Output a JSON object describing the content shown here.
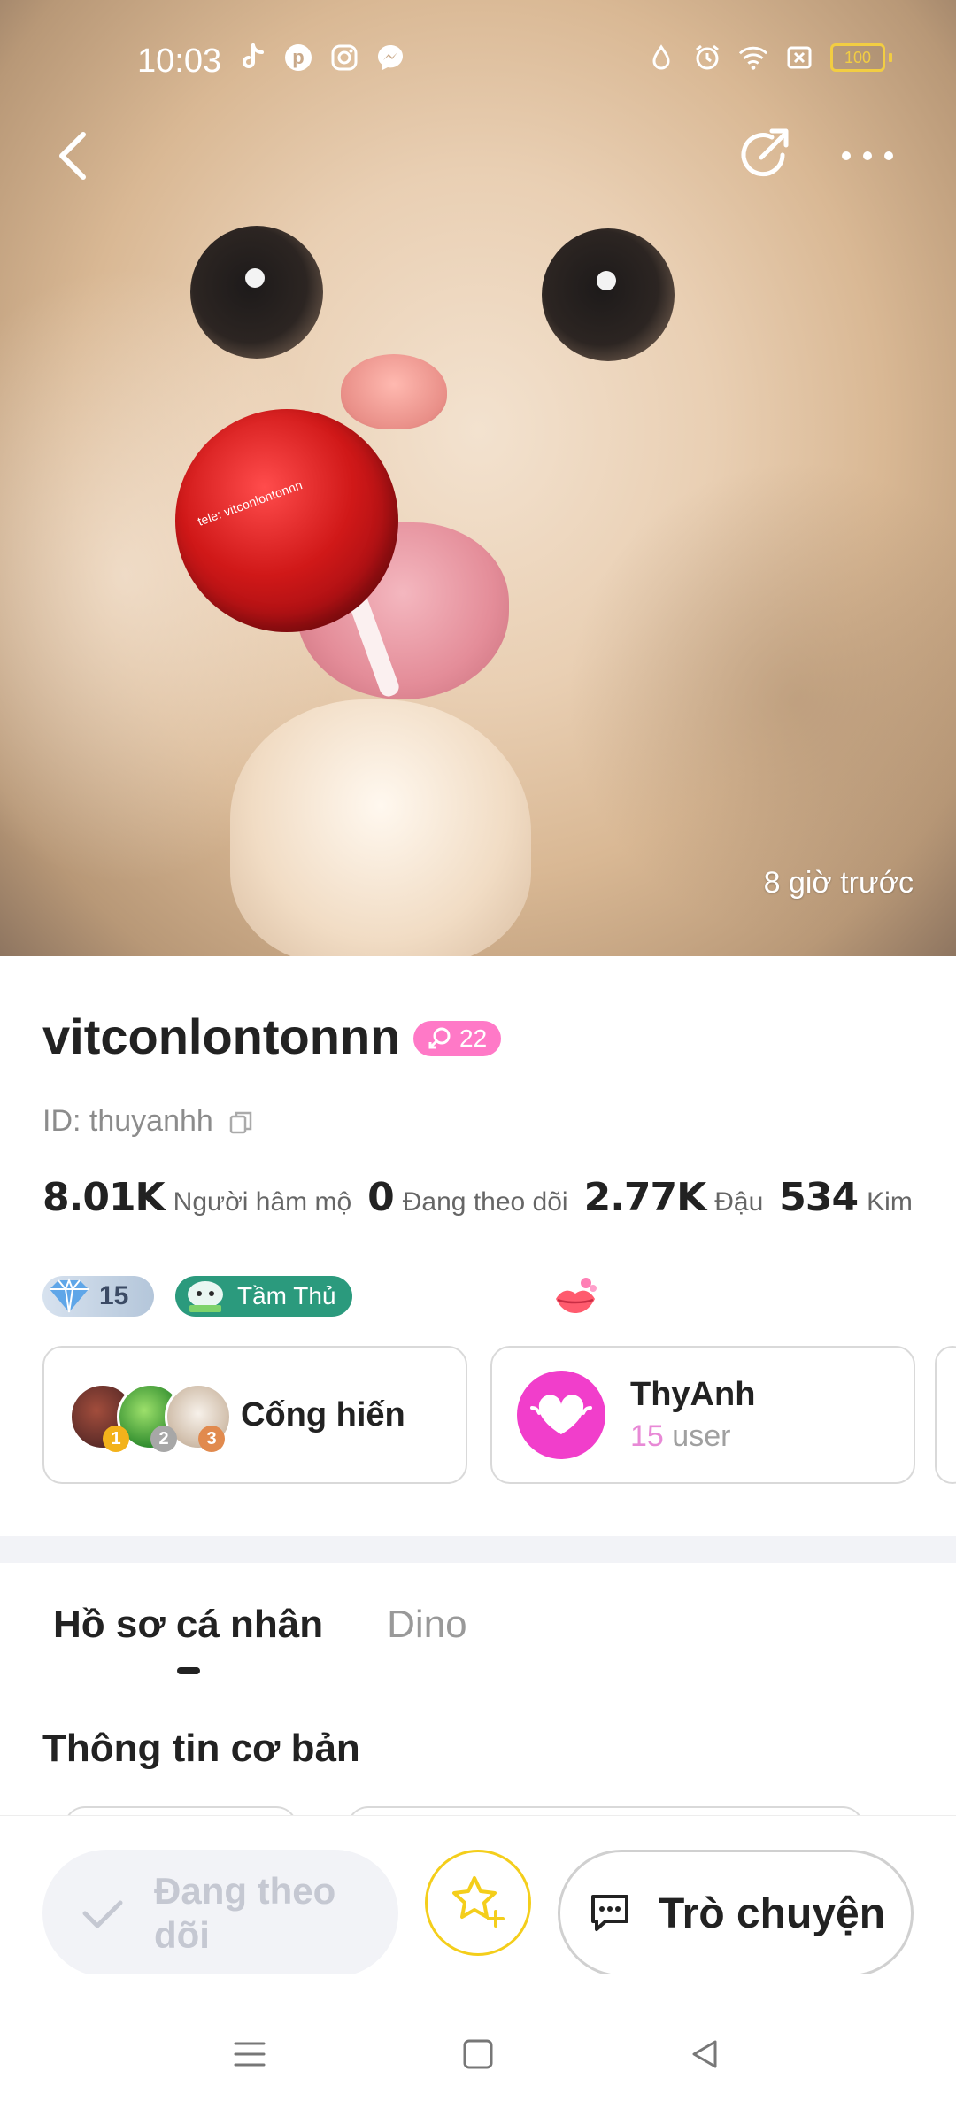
{
  "status_bar": {
    "time": "10:03",
    "app_icons": [
      "tiktok-icon",
      "pinterest-icon",
      "instagram-icon",
      "messenger-icon"
    ],
    "system_icons": [
      "water-drop-icon",
      "alarm-icon",
      "wifi-icon",
      "sim-x-icon"
    ],
    "battery": "100"
  },
  "header": {
    "back_icon": "chevron-left-icon",
    "share_icon": "share-icon",
    "more_icon": "more-dots-icon"
  },
  "photo": {
    "lollipop_text": "tele: vitconlontonnn",
    "timestamp": "8 giờ trước"
  },
  "profile": {
    "username": "vitconlontonnn",
    "level": "22",
    "id_label": "ID: thuyanhh",
    "stats": [
      {
        "value": "8.01K",
        "label": "Người hâm mộ"
      },
      {
        "value": "0",
        "label": "Đang theo dõi"
      },
      {
        "value": "2.77K",
        "label": "Đậu"
      },
      {
        "value": "534",
        "label": "Kim"
      }
    ],
    "diamond_count": "15",
    "rank_badge": "Tầm Thủ"
  },
  "cards": {
    "contribution": {
      "label": "Cống hiến",
      "ranks": [
        "1",
        "2",
        "3"
      ]
    },
    "fan_club": {
      "name": "ThyAnh",
      "count": "15",
      "unit": "user"
    }
  },
  "tabs": [
    {
      "label": "Hồ sơ cá nhân",
      "active": true
    },
    {
      "label": "Dino",
      "active": false
    }
  ],
  "section": {
    "title": "Thông tin cơ bản"
  },
  "actions": {
    "follow_line1": "Đang theo",
    "follow_line2": "dõi",
    "chat_label": "Trò chuyện"
  },
  "colors": {
    "level_pink": "#ff79c7",
    "rank_green": "#2b9a7d",
    "fan_magenta": "#f13ecb",
    "star_yellow": "#f4ce1b",
    "fan_sub_pink": "#e889d6"
  }
}
